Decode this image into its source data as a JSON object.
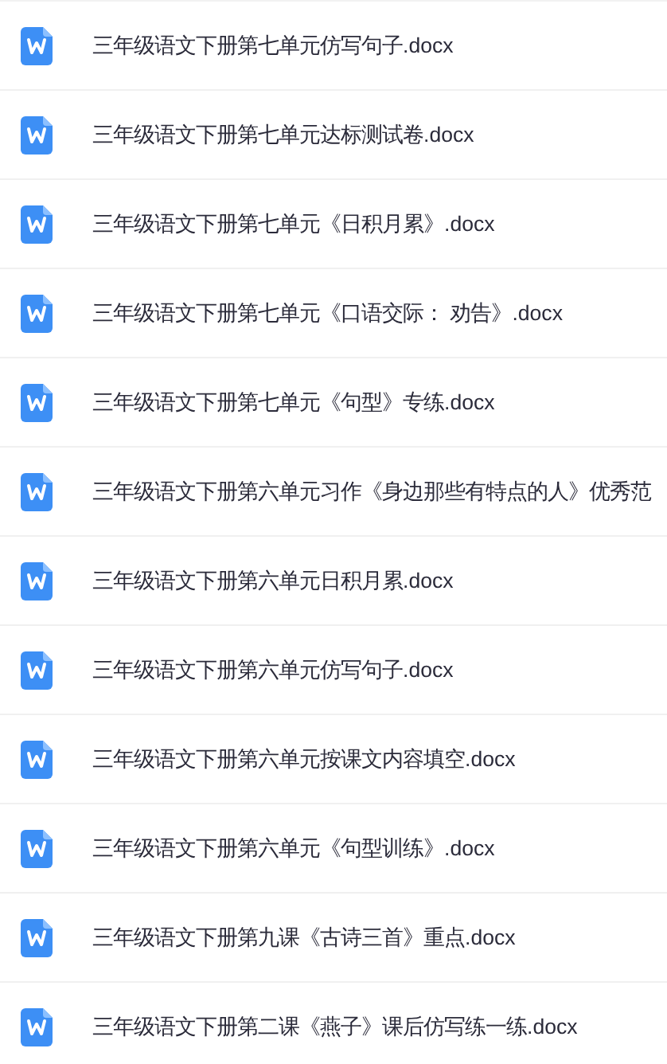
{
  "files": [
    {
      "name": "三年级语文下册第七单元仿写句子.docx"
    },
    {
      "name": "三年级语文下册第七单元达标测试卷.docx"
    },
    {
      "name": "三年级语文下册第七单元《日积月累》.docx"
    },
    {
      "name": "三年级语文下册第七单元《口语交际： 劝告》.docx"
    },
    {
      "name": "三年级语文下册第七单元《句型》专练.docx"
    },
    {
      "name": "三年级语文下册第六单元习作《身边那些有特点的人》优秀范"
    },
    {
      "name": "三年级语文下册第六单元日积月累.docx"
    },
    {
      "name": "三年级语文下册第六单元仿写句子.docx"
    },
    {
      "name": "三年级语文下册第六单元按课文内容填空.docx"
    },
    {
      "name": "三年级语文下册第六单元《句型训练》.docx"
    },
    {
      "name": "三年级语文下册第九课《古诗三首》重点.docx"
    },
    {
      "name": "三年级语文下册第二课《燕子》课后仿写练一练.docx"
    }
  ]
}
